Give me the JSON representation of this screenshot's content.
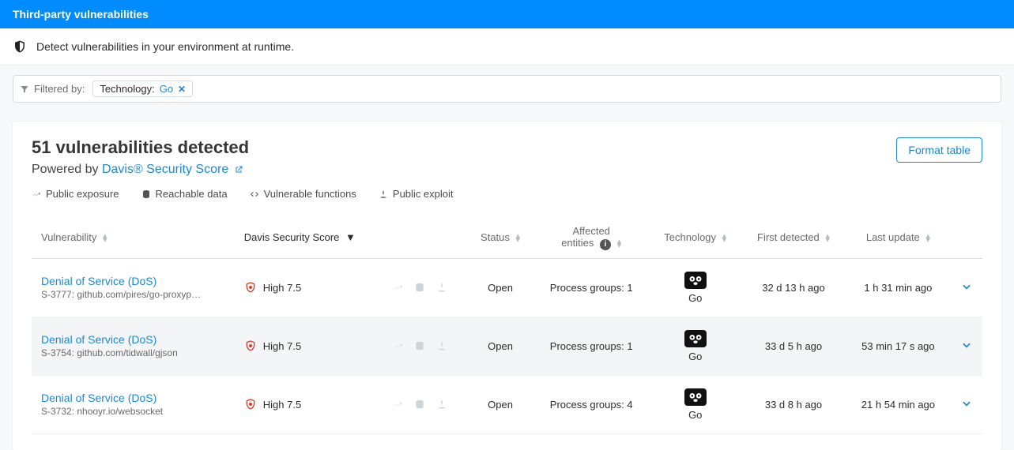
{
  "topbar": {
    "title": "Third-party vulnerabilities"
  },
  "subtitle": {
    "text": "Detect vulnerabilities in your environment at runtime."
  },
  "filter": {
    "label": "Filtered by:",
    "chip_key": "Technology:",
    "chip_value": "Go"
  },
  "panel": {
    "title": "51 vulnerabilities detected",
    "powered_prefix": "Powered by ",
    "powered_link": "Davis® Security Score",
    "format_button": "Format table"
  },
  "legend": {
    "public_exposure": "Public exposure",
    "reachable_data": "Reachable data",
    "vulnerable_functions": "Vulnerable functions",
    "public_exploit": "Public exploit"
  },
  "columns": {
    "vulnerability": "Vulnerability",
    "score": "Davis Security Score",
    "status": "Status",
    "affected": "Affected\nentities",
    "technology": "Technology",
    "first_detected": "First detected",
    "last_update": "Last update"
  },
  "rows": [
    {
      "title": "Denial of Service (DoS)",
      "sub": "S-3777: github.com/pires/go-proxyp…",
      "score_label": "High 7.5",
      "status": "Open",
      "affected": "Process groups: 1",
      "tech": "Go",
      "first": "32 d 13 h ago",
      "last": "1 h 31 min ago"
    },
    {
      "title": "Denial of Service (DoS)",
      "sub": "S-3754: github.com/tidwall/gjson",
      "score_label": "High 7.5",
      "status": "Open",
      "affected": "Process groups: 1",
      "tech": "Go",
      "first": "33 d 5 h ago",
      "last": "53 min 17 s ago"
    },
    {
      "title": "Denial of Service (DoS)",
      "sub": "S-3732: nhooyr.io/websocket",
      "score_label": "High 7.5",
      "status": "Open",
      "affected": "Process groups: 4",
      "tech": "Go",
      "first": "33 d 8 h ago",
      "last": "21 h 54 min ago"
    }
  ]
}
